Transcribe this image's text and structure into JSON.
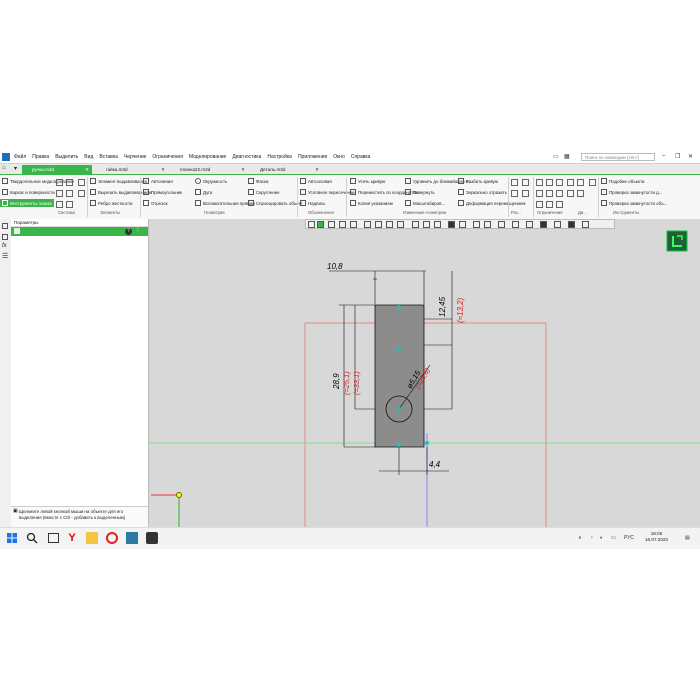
{
  "menu": [
    "Файл",
    "Правка",
    "Выделить",
    "Вид",
    "Вставка",
    "Черчение",
    "Ограничения",
    "Моделирование",
    "Диагностика",
    "Настройка",
    "Приложения",
    "Окно",
    "Справка"
  ],
  "search_placeholder": "Поиск по командам (Alt+/)",
  "tabs": [
    {
      "label": "ручка.m3d",
      "active": true
    },
    {
      "label": "гайка.m3d",
      "active": false
    },
    {
      "label": "планка22.m3d",
      "active": false
    },
    {
      "label": "Деталь.m3d",
      "active": false
    }
  ],
  "ribbon": {
    "left_modes": [
      "Твердотельное моделирование",
      "Каркас и поверхности",
      "Инструменты эскиза"
    ],
    "col1": [
      "Элемент выдавливания",
      "Вырезать выдавливанием",
      "Ребро жесткости"
    ],
    "geom_a": [
      "Автолиния",
      "Прямоугольник",
      "Отрезок"
    ],
    "geom_b": [
      "Окружность",
      "Дуга",
      "Вспомогательная прямая"
    ],
    "geom_c": [
      "Фаска",
      "Скругление",
      "Спроецировать объект"
    ],
    "annot": [
      "Автоосевая",
      "Условное пересечение",
      "Надпись"
    ],
    "edit_a": [
      "Усечь кривую",
      "Переместить по координатам",
      "Копия указанием"
    ],
    "edit_b": [
      "Удлинить до ближайшего о...",
      "Повернуть",
      "Масштабиров..."
    ],
    "edit_c": [
      "Разбить кривую",
      "Зеркально отразить",
      "Деформация перемещением"
    ],
    "right": [
      "Подобие объекта",
      "Проверка замкнутости д...",
      "Проверка замкнутости объ..."
    ],
    "groups": [
      "Система",
      "Элементы",
      "Геометрия",
      "Обозначения",
      "Изменение геометрии",
      "Раз...",
      "Ограничения",
      "Ди...",
      "Инструменты"
    ]
  },
  "panel": {
    "title": "Параметры",
    "hint": "Щелкните левой кнопкой мыши на объекте для его выделения (вместе с Ctrl - добавить к выделенным)"
  },
  "drawing": {
    "dims": [
      "10,8",
      "12,45",
      "(≈13,2)",
      "28,9",
      "(≈25,1)",
      "(≈33,1)",
      "ø5,15",
      "(≈25,6)",
      "4,4"
    ]
  },
  "taskbar": {
    "lang": "РУС",
    "time": "18:05",
    "date": "16.07.2023"
  },
  "colors": {
    "accent": "#39b54a",
    "dim": "#000000",
    "ref_dim": "#d42020",
    "point": "#19c2c2"
  }
}
